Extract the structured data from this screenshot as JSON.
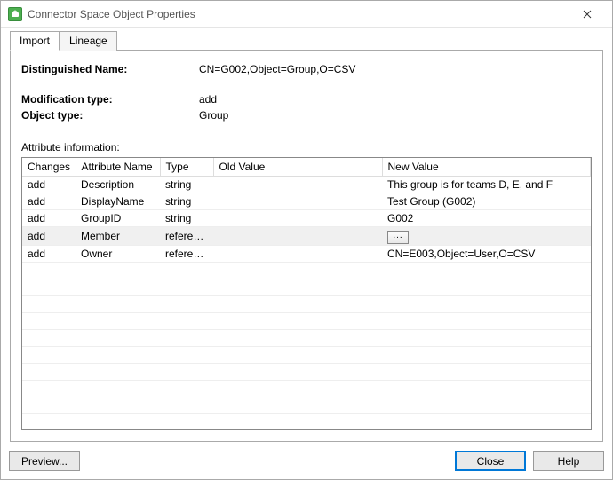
{
  "window": {
    "title": "Connector Space Object Properties"
  },
  "tabs": {
    "import": "Import",
    "lineage": "Lineage"
  },
  "fields": {
    "dn_label": "Distinguished Name:",
    "dn_value": "CN=G002,Object=Group,O=CSV",
    "modtype_label": "Modification type:",
    "modtype_value": "add",
    "objtype_label": "Object type:",
    "objtype_value": "Group",
    "attrinfo_label": "Attribute information:"
  },
  "table": {
    "headers": {
      "changes": "Changes",
      "attr": "Attribute Name",
      "type": "Type",
      "old": "Old Value",
      "new": "New Value"
    },
    "r0": {
      "changes": "add",
      "attr": "Description",
      "type": "string",
      "old": "",
      "new": "This group is for teams D, E, and F"
    },
    "r1": {
      "changes": "add",
      "attr": "DisplayName",
      "type": "string",
      "old": "",
      "new": "Test Group (G002)"
    },
    "r2": {
      "changes": "add",
      "attr": "GroupID",
      "type": "string",
      "old": "",
      "new": "G002"
    },
    "r3": {
      "changes": "add",
      "attr": "Member",
      "type": "reference",
      "old": "",
      "new": ""
    },
    "r4": {
      "changes": "add",
      "attr": "Owner",
      "type": "reference",
      "old": "",
      "new": "CN=E003,Object=User,O=CSV"
    }
  },
  "buttons": {
    "preview": "Preview...",
    "close": "Close",
    "help": "Help",
    "ellipsis": "..."
  }
}
